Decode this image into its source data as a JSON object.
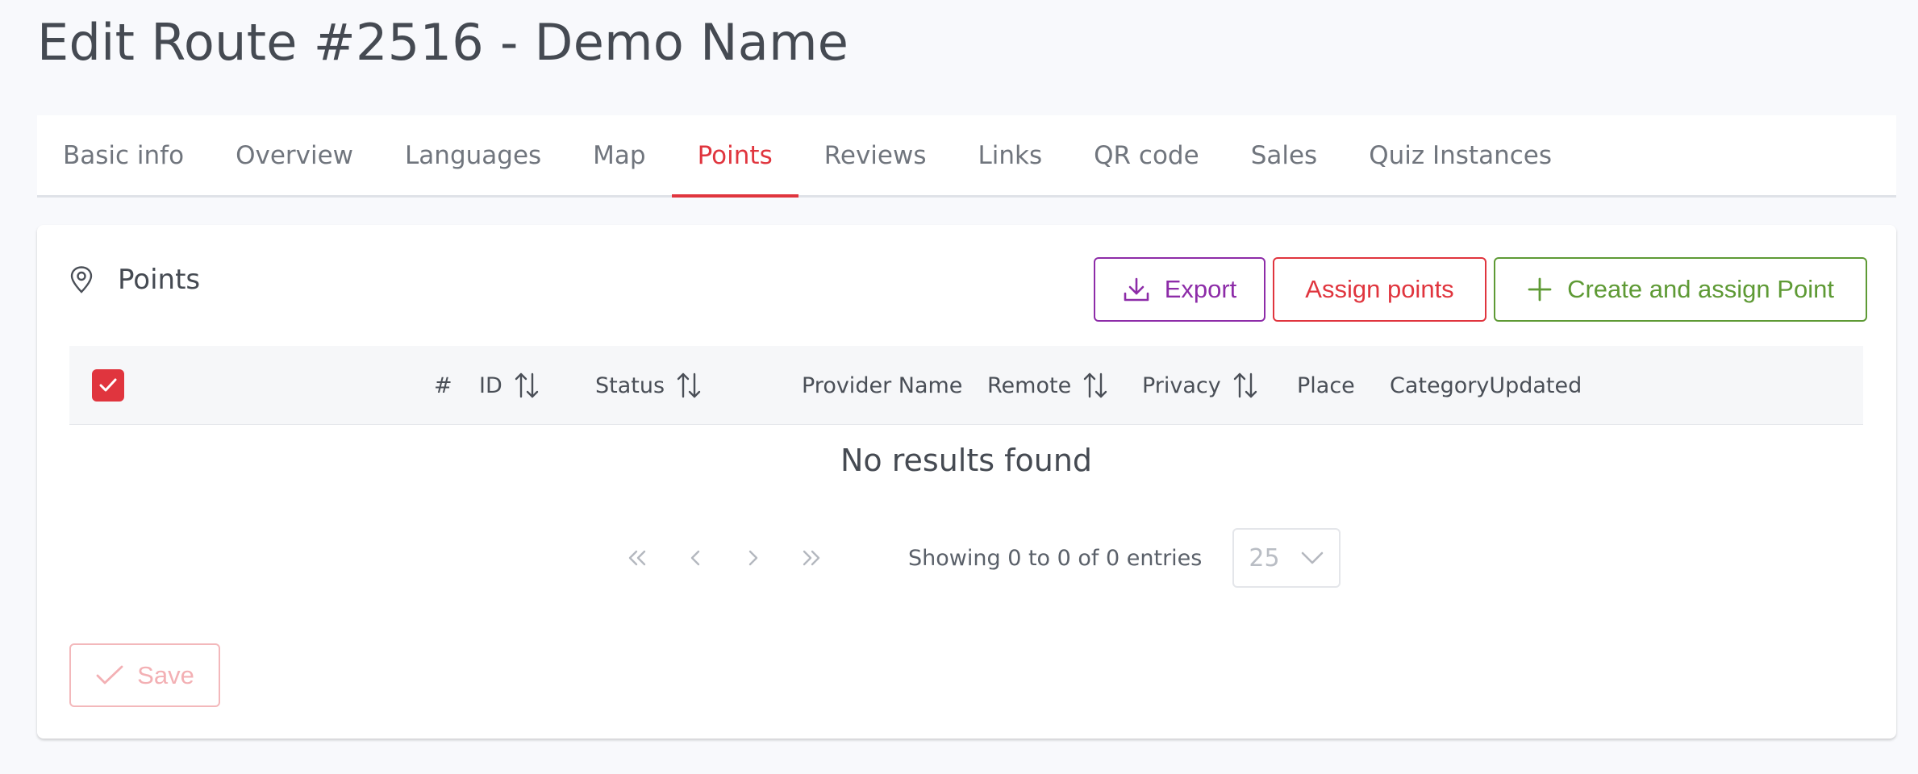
{
  "page": {
    "title": "Edit Route #2516 - Demo Name"
  },
  "tabs": [
    {
      "label": "Basic info",
      "active": false
    },
    {
      "label": "Overview",
      "active": false
    },
    {
      "label": "Languages",
      "active": false
    },
    {
      "label": "Map",
      "active": false
    },
    {
      "label": "Points",
      "active": true
    },
    {
      "label": "Reviews",
      "active": false
    },
    {
      "label": "Links",
      "active": false
    },
    {
      "label": "QR code",
      "active": false
    },
    {
      "label": "Sales",
      "active": false
    },
    {
      "label": "Quiz Instances",
      "active": false
    }
  ],
  "card": {
    "title": "Points",
    "icon": "map-pin-icon",
    "buttons": {
      "export": "Export",
      "assign": "Assign points",
      "create": "Create and assign Point"
    }
  },
  "table": {
    "select_all_checked": true,
    "columns": {
      "num": "#",
      "id": "ID",
      "status": "Status",
      "provider": "Provider Name",
      "remote": "Remote",
      "privacy": "Privacy",
      "place": "Place",
      "category_updated": "CategoryUpdated"
    },
    "empty_message": "No results found"
  },
  "pagination": {
    "summary": "Showing 0 to 0 of 0 entries",
    "page_size": "25"
  },
  "footer": {
    "save_label": "Save"
  },
  "colors": {
    "accent": "#e0353e",
    "export": "#8d2ca8",
    "create": "#5e9a35",
    "save_disabled": "#f3b0b4"
  }
}
